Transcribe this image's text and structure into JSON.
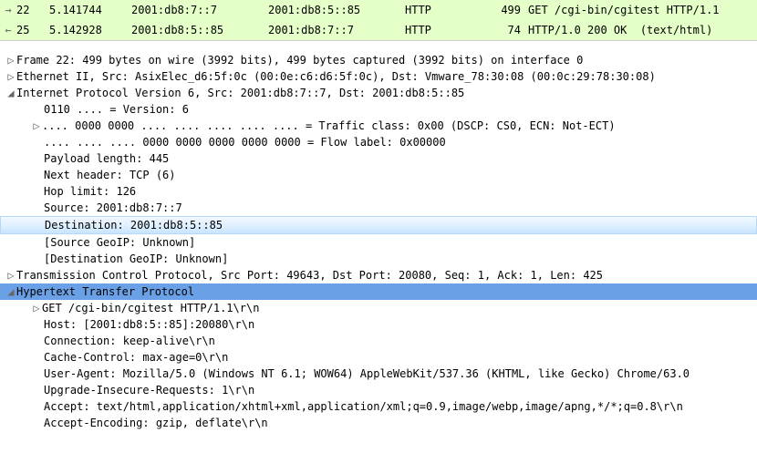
{
  "packets": [
    {
      "arrow": "→",
      "num": "22",
      "time": "5.141744",
      "src": "2001:db8:7::7",
      "dst": "2001:db8:5::85",
      "proto": "HTTP",
      "len": "499",
      "info": "GET /cgi-bin/cgitest HTTP/1.1"
    },
    {
      "arrow": "←",
      "num": "25",
      "time": "5.142928",
      "src": "2001:db8:5::85",
      "dst": "2001:db8:7::7",
      "proto": "HTTP",
      "len": "74",
      "info": "HTTP/1.0 200 OK  (text/html)"
    }
  ],
  "tree": {
    "frame": "Frame 22: 499 bytes on wire (3992 bits), 499 bytes captured (3992 bits) on interface 0",
    "eth": "Ethernet II, Src: AsixElec_d6:5f:0c (00:0e:c6:d6:5f:0c), Dst: Vmware_78:30:08 (00:0c:29:78:30:08)",
    "ipv6": "Internet Protocol Version 6, Src: 2001:db8:7::7, Dst: 2001:db8:5::85",
    "ipv6_ver": "0110 .... = Version: 6",
    "ipv6_tc": ".... 0000 0000 .... .... .... .... .... = Traffic class: 0x00 (DSCP: CS0, ECN: Not-ECT)",
    "ipv6_flow": ".... .... .... 0000 0000 0000 0000 0000 = Flow label: 0x00000",
    "ipv6_plen": "Payload length: 445",
    "ipv6_nh": "Next header: TCP (6)",
    "ipv6_hop": "Hop limit: 126",
    "ipv6_src": "Source: 2001:db8:7::7",
    "ipv6_dst": "Destination: 2001:db8:5::85",
    "ipv6_srcgeo": "[Source GeoIP: Unknown]",
    "ipv6_dstgeo": "[Destination GeoIP: Unknown]",
    "tcp": "Transmission Control Protocol, Src Port: 49643, Dst Port: 20080, Seq: 1, Ack: 1, Len: 425",
    "http": "Hypertext Transfer Protocol",
    "http_get": "GET /cgi-bin/cgitest HTTP/1.1\\r\\n",
    "http_host": "Host: [2001:db8:5::85]:20080\\r\\n",
    "http_conn": "Connection: keep-alive\\r\\n",
    "http_cache": "Cache-Control: max-age=0\\r\\n",
    "http_ua": "User-Agent: Mozilla/5.0 (Windows NT 6.1; WOW64) AppleWebKit/537.36 (KHTML, like Gecko) Chrome/63.0",
    "http_uir": "Upgrade-Insecure-Requests: 1\\r\\n",
    "http_accept": "Accept: text/html,application/xhtml+xml,application/xml;q=0.9,image/webp,image/apng,*/*;q=0.8\\r\\n",
    "http_accenc": "Accept-Encoding: gzip, deflate\\r\\n"
  },
  "glyph": {
    "closed": "▷",
    "open": "◢"
  }
}
